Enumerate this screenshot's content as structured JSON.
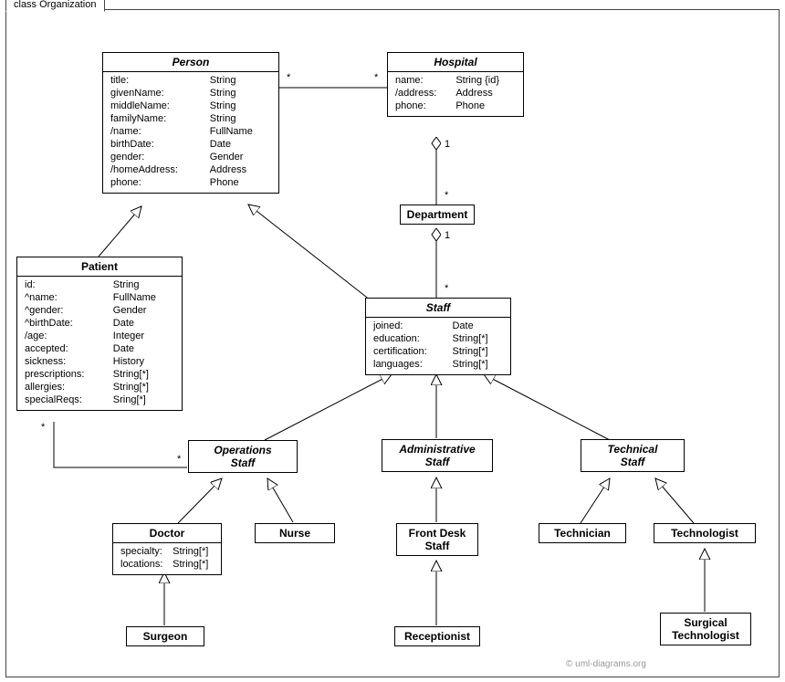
{
  "frame": {
    "title": "class Organization"
  },
  "watermark": "© uml-diagrams.org",
  "classes": {
    "person": {
      "name": "Person",
      "attrs": [
        [
          "title:",
          "String"
        ],
        [
          "givenName:",
          "String"
        ],
        [
          "middleName:",
          "String"
        ],
        [
          "familyName:",
          "String"
        ],
        [
          "/name:",
          "FullName"
        ],
        [
          "birthDate:",
          "Date"
        ],
        [
          "gender:",
          "Gender"
        ],
        [
          "/homeAddress:",
          "Address"
        ],
        [
          "phone:",
          "Phone"
        ]
      ]
    },
    "hospital": {
      "name": "Hospital",
      "attrs": [
        [
          "name:",
          "String {id}"
        ],
        [
          "/address:",
          "Address"
        ],
        [
          "phone:",
          "Phone"
        ]
      ]
    },
    "department": {
      "name": "Department"
    },
    "patient": {
      "name": "Patient",
      "attrs": [
        [
          "id:",
          "String"
        ],
        [
          "^name:",
          "FullName"
        ],
        [
          "^gender:",
          "Gender"
        ],
        [
          "^birthDate:",
          "Date"
        ],
        [
          "/age:",
          "Integer"
        ],
        [
          "accepted:",
          "Date"
        ],
        [
          "sickness:",
          "History"
        ],
        [
          "prescriptions:",
          "String[*]"
        ],
        [
          "allergies:",
          "String[*]"
        ],
        [
          "specialReqs:",
          "Sring[*]"
        ]
      ]
    },
    "staff": {
      "name": "Staff",
      "attrs": [
        [
          "joined:",
          "Date"
        ],
        [
          "education:",
          "String[*]"
        ],
        [
          "certification:",
          "String[*]"
        ],
        [
          "languages:",
          "String[*]"
        ]
      ]
    },
    "opsStaff": {
      "name1": "Operations",
      "name2": "Staff"
    },
    "adminStaff": {
      "name1": "Administrative",
      "name2": "Staff"
    },
    "techStaff": {
      "name1": "Technical",
      "name2": "Staff"
    },
    "doctor": {
      "name": "Doctor",
      "attrs": [
        [
          "specialty:",
          "String[*]"
        ],
        [
          "locations:",
          "String[*]"
        ]
      ]
    },
    "nurse": {
      "name": "Nurse"
    },
    "frontDesk": {
      "name1": "Front Desk",
      "name2": "Staff"
    },
    "technician": {
      "name": "Technician"
    },
    "technologist": {
      "name": "Technologist"
    },
    "surgeon": {
      "name": "Surgeon"
    },
    "receptionist": {
      "name": "Receptionist"
    },
    "surgTech": {
      "name1": "Surgical",
      "name2": "Technologist"
    }
  },
  "mult": {
    "personHospL": "*",
    "personHospR": "*",
    "hospDeptTop": "1",
    "hospDeptBot": "*",
    "deptStaffTop": "1",
    "deptStaffBot": "*",
    "patientOpsL": "*",
    "patientOpsR": "*"
  }
}
